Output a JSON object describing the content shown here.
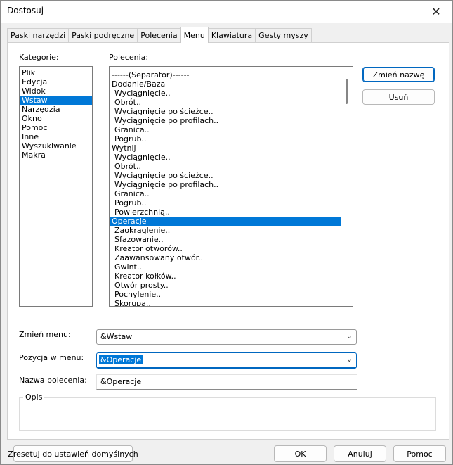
{
  "window": {
    "title": "Dostosuj",
    "close_glyph": "✕"
  },
  "tabs": [
    {
      "label": "Paski narzędzi"
    },
    {
      "label": "Paski podręczne"
    },
    {
      "label": "Polecenia"
    },
    {
      "label": "Menu",
      "active": true
    },
    {
      "label": "Klawiatura"
    },
    {
      "label": "Gesty myszy"
    }
  ],
  "categories": {
    "label": "Kategorie:",
    "items": [
      "Plik",
      "Edycja",
      "Widok",
      "Wstaw",
      "Narzędzia",
      "Okno",
      "Pomoc",
      "Inne",
      "Wyszukiwanie",
      "Makra"
    ],
    "selected": "Wstaw"
  },
  "commands": {
    "label": "Polecenia:",
    "items": [
      {
        "text": "------(Separator)------",
        "indent": false
      },
      {
        "text": "Dodanie/Baza",
        "indent": false
      },
      {
        "text": "Wyciągnięcie..",
        "indent": true
      },
      {
        "text": "Obrót..",
        "indent": true
      },
      {
        "text": "Wyciągnięcie po ścieżce..",
        "indent": true
      },
      {
        "text": "Wyciągnięcie po profilach..",
        "indent": true
      },
      {
        "text": "Granica..",
        "indent": true
      },
      {
        "text": "Pogrub..",
        "indent": true
      },
      {
        "text": "Wytnij",
        "indent": false
      },
      {
        "text": "Wyciągnięcie..",
        "indent": true
      },
      {
        "text": "Obrót..",
        "indent": true
      },
      {
        "text": "Wyciągnięcie po ścieżce..",
        "indent": true
      },
      {
        "text": "Wyciągnięcie po profilach..",
        "indent": true
      },
      {
        "text": "Granica..",
        "indent": true
      },
      {
        "text": "Pogrub..",
        "indent": true
      },
      {
        "text": "Powierzchnią..",
        "indent": true
      },
      {
        "text": "Operacje",
        "indent": false,
        "selected": true
      },
      {
        "text": "Zaokrąglenie..",
        "indent": true
      },
      {
        "text": "Sfazowanie..",
        "indent": true
      },
      {
        "text": "Kreator otworów..",
        "indent": true
      },
      {
        "text": "Zaawansowany otwór..",
        "indent": true
      },
      {
        "text": "Gwint..",
        "indent": true
      },
      {
        "text": "Kreator kołków..",
        "indent": true
      },
      {
        "text": "Otwór prosty..",
        "indent": true
      },
      {
        "text": "Pochylenie..",
        "indent": true
      },
      {
        "text": "Skorupa..",
        "indent": true
      }
    ]
  },
  "side_buttons": {
    "rename": "Zmień nazwę",
    "delete": "Usuń"
  },
  "change_menu": {
    "label": "Zmień menu:",
    "value": "&Wstaw"
  },
  "menu_position": {
    "label": "Pozycja w menu:",
    "value": "&Operacje"
  },
  "command_name": {
    "label": "Nazwa polecenia:",
    "value": "&Operacje"
  },
  "description": {
    "label": "Opis",
    "value": ""
  },
  "footer": {
    "reset": "Zresetuj do ustawień domyślnych",
    "ok": "OK",
    "cancel": "Anuluj",
    "help": "Pomoc"
  },
  "colors": {
    "selection": "#0078d7",
    "focus": "#0067c0"
  },
  "icons": {
    "dropdown": "chevron-down-icon",
    "close": "close-icon"
  }
}
